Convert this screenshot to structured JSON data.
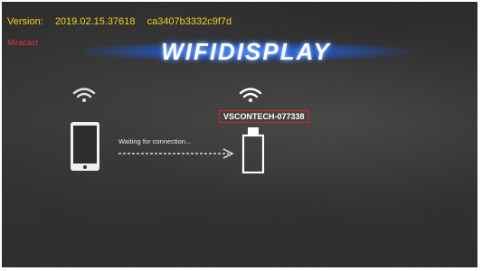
{
  "header": {
    "version_label": "Version:",
    "version_number": "2019.02.15.37618",
    "build_hash": "ca3407b3332c9f7d",
    "mode_label": "Miracast"
  },
  "banner": {
    "title": "WIFIDISPLAY"
  },
  "connection": {
    "device_name": "VSCONTECH-077338",
    "status_text": "Waiting for connection..."
  },
  "icons": {
    "wifi_source": "wifi-icon",
    "wifi_target": "wifi-icon",
    "source_device": "phone-icon",
    "target_device": "dongle-icon",
    "direction": "arrow-right-icon"
  },
  "colors": {
    "version_text": "#f2d21b",
    "mode_label": "#e0323a",
    "banner_glow": "#3d7dff",
    "device_highlight": "#d4262b"
  }
}
